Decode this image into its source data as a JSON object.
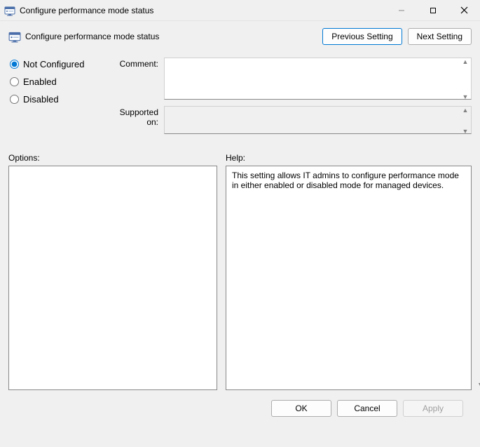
{
  "titlebar": {
    "title": "Configure performance mode status"
  },
  "header": {
    "title": "Configure performance mode status"
  },
  "nav": {
    "previous": "Previous Setting",
    "next": "Next Setting"
  },
  "radios": {
    "not_configured": "Not Configured",
    "enabled": "Enabled",
    "disabled": "Disabled",
    "selected": "not_configured"
  },
  "fields": {
    "comment_label": "Comment:",
    "comment_value": "",
    "supported_label": "Supported on:",
    "supported_value": ""
  },
  "lower": {
    "options_label": "Options:",
    "help_label": "Help:",
    "options_content": "",
    "help_content": "This setting allows IT admins to configure performance mode in either enabled or disabled mode for managed devices."
  },
  "footer": {
    "ok": "OK",
    "cancel": "Cancel",
    "apply": "Apply"
  }
}
